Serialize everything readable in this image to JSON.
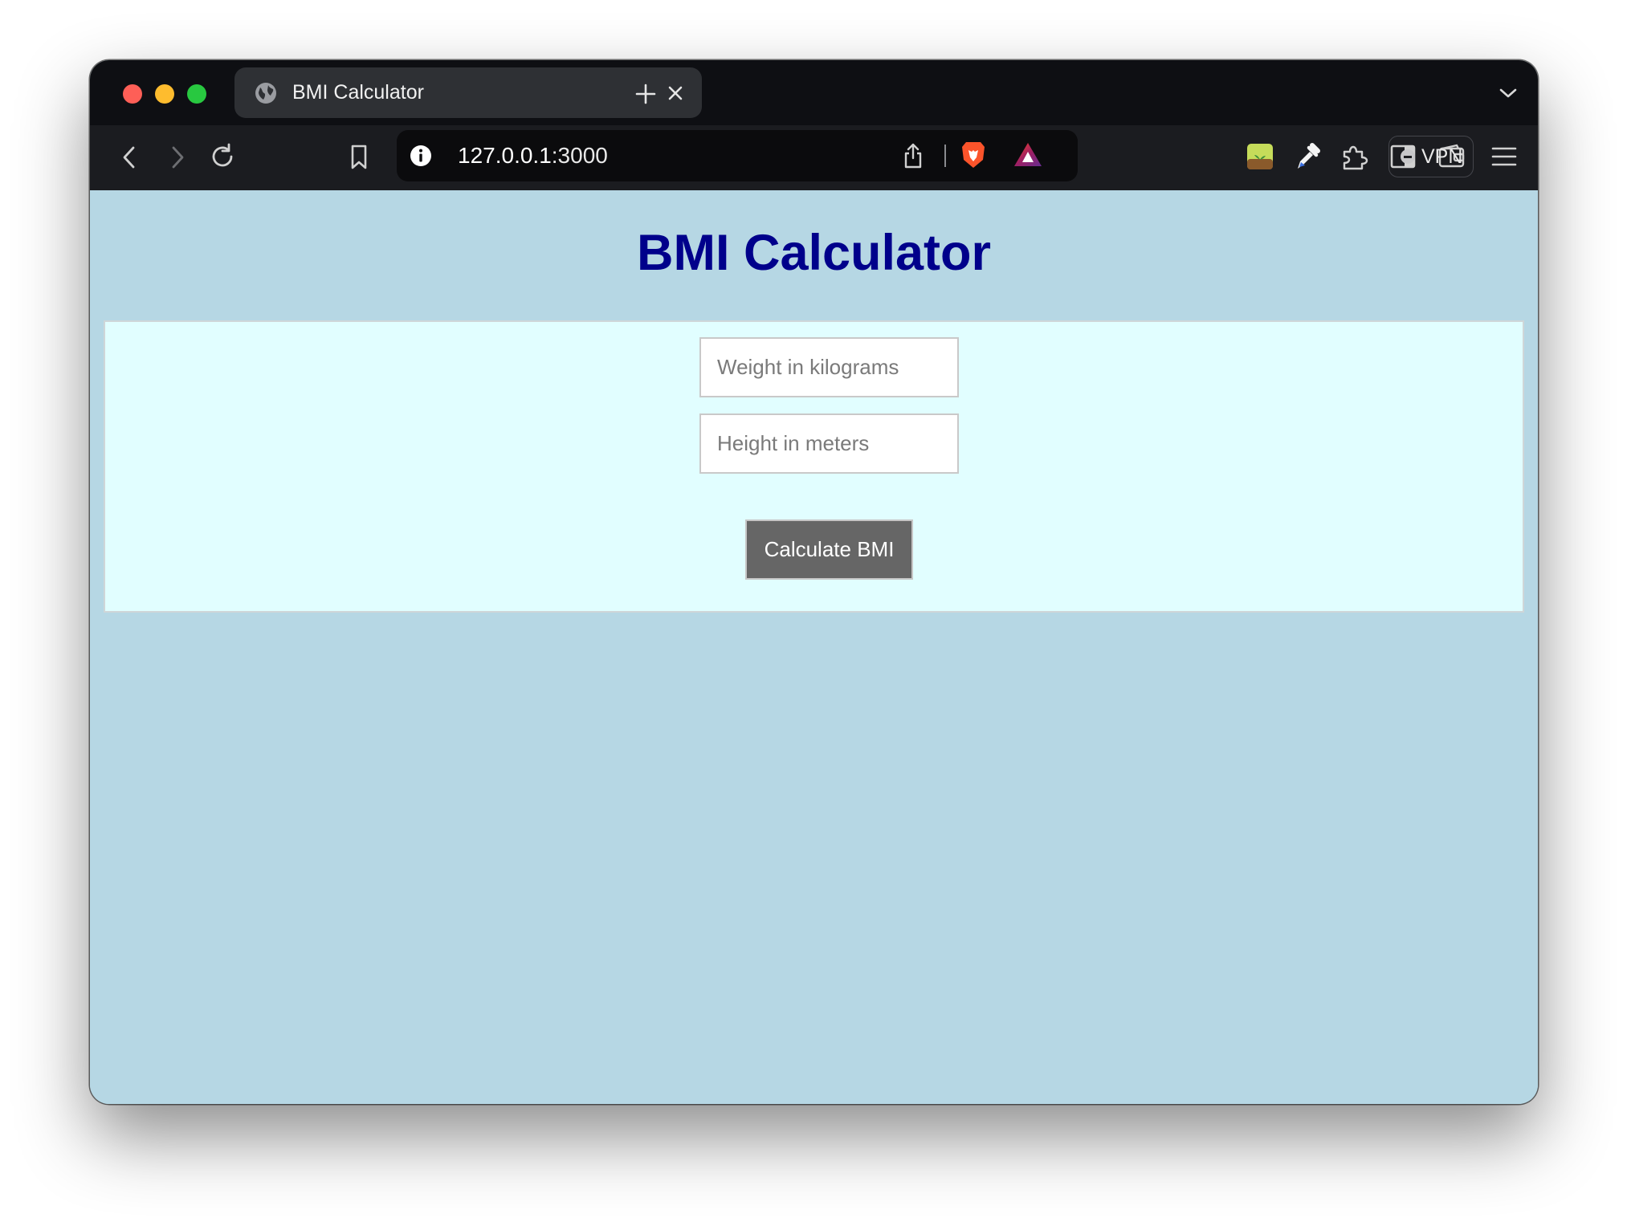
{
  "browser": {
    "tab": {
      "title": "BMI Calculator",
      "favicon": "globe-icon"
    },
    "address_bar": {
      "host": "127.0.0.1",
      "port": ":3000"
    },
    "vpn_label": "VPN",
    "colors": {
      "tabstrip": "#0e0f13",
      "toolbar": "#1b1c20",
      "omnibox": "#0b0b0d",
      "active_tab": "#2e3034"
    }
  },
  "page": {
    "title": "BMI Calculator",
    "form": {
      "weight_placeholder": "Weight in kilograms",
      "weight_value": "",
      "height_placeholder": "Height in meters",
      "height_value": "",
      "submit_label": "Calculate BMI"
    },
    "colors": {
      "background": "#b6d7e4",
      "card": "#e1feff",
      "title": "#00008b",
      "button": "#666666"
    }
  }
}
